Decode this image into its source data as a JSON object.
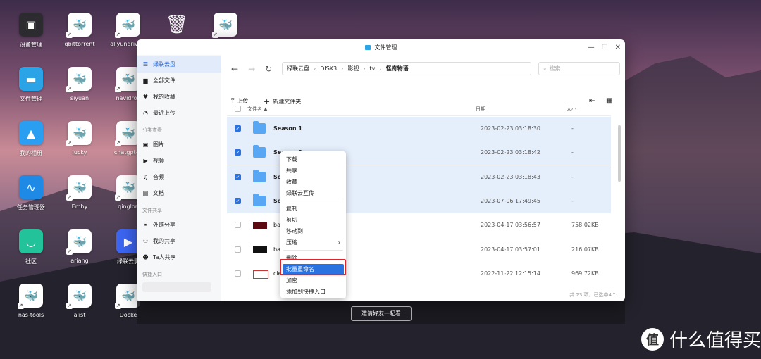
{
  "desktop": {
    "icons": [
      {
        "label": "设备管理",
        "icon": "device-icon"
      },
      {
        "label": "qbittorrent",
        "icon": "docker-icon"
      },
      {
        "label": "aliyundrive-s",
        "icon": "docker-icon"
      },
      {
        "label": "",
        "icon": "trash-icon"
      },
      {
        "label": "",
        "icon": "docker-icon"
      },
      {
        "label": "文件管理",
        "icon": "folder-icon"
      },
      {
        "label": "siyuan",
        "icon": "docker-icon"
      },
      {
        "label": "navidron",
        "icon": "docker-icon"
      },
      {
        "label": "我的相册",
        "icon": "photo-icon"
      },
      {
        "label": "lucky",
        "icon": "docker-icon"
      },
      {
        "label": "chatgpt-w",
        "icon": "docker-icon"
      },
      {
        "label": "任务管理器",
        "icon": "chart-icon"
      },
      {
        "label": "Emby",
        "icon": "docker-icon"
      },
      {
        "label": "qinglon",
        "icon": "docker-icon"
      },
      {
        "label": "社区",
        "icon": "community-icon"
      },
      {
        "label": "ariang",
        "icon": "docker-icon"
      },
      {
        "label": "绿联云影",
        "icon": "tv-icon"
      },
      {
        "label": "nas-tools",
        "icon": "docker-icon"
      },
      {
        "label": "alist",
        "icon": "docker-icon"
      },
      {
        "label": "Docke",
        "icon": "docker-icon"
      }
    ]
  },
  "window": {
    "title": "文件管理",
    "controls": [
      "—",
      "☐",
      "✕"
    ]
  },
  "sidebar": {
    "items": [
      {
        "label": "绿联云盘",
        "icon": "list-icon",
        "active": true
      },
      {
        "label": "全部文件",
        "icon": "file-icon"
      },
      {
        "label": "我的收藏",
        "icon": "heart-icon"
      },
      {
        "label": "最近上传",
        "icon": "clock-icon"
      }
    ],
    "section_category": "分类查看",
    "categories": [
      {
        "label": "图片",
        "icon": "image-icon"
      },
      {
        "label": "视频",
        "icon": "video-icon"
      },
      {
        "label": "音频",
        "icon": "headphone-icon"
      },
      {
        "label": "文档",
        "icon": "doc-icon"
      }
    ],
    "section_share": "文件共享",
    "shares": [
      {
        "label": "外链分享",
        "icon": "link-icon"
      },
      {
        "label": "我的共享",
        "icon": "share-icon"
      },
      {
        "label": "Ta人共享",
        "icon": "user-icon"
      }
    ],
    "section_quick": "快捷入口"
  },
  "breadcrumb": [
    "绿联云盘",
    "DISK3",
    "影视",
    "tv",
    "怪奇物语"
  ],
  "search": {
    "placeholder": "搜索"
  },
  "toolbar": {
    "upload": "上传",
    "new_folder": "新建文件夹"
  },
  "table": {
    "headers": {
      "name": "文件名",
      "date": "日期",
      "size": "大小"
    },
    "rows": [
      {
        "name": "Season 1",
        "date": "2023-02-23 03:18:30",
        "size": "-",
        "type": "folder",
        "checked": true
      },
      {
        "name": "Season 2",
        "date": "2023-02-23 03:18:42",
        "size": "-",
        "type": "folder",
        "checked": true
      },
      {
        "name": "Seas",
        "date": "2023-02-23 03:18:43",
        "size": "-",
        "type": "folder",
        "checked": true
      },
      {
        "name": "Seas",
        "date": "2023-07-06 17:49:45",
        "size": "-",
        "type": "folder",
        "checked": true
      },
      {
        "name": "backg",
        "date": "2023-04-17 03:56:57",
        "size": "758.02KB",
        "type": "image",
        "checked": false
      },
      {
        "name": "banne",
        "date": "2023-04-17 03:57:01",
        "size": "216.07KB",
        "type": "image",
        "checked": false
      },
      {
        "name": "clear",
        "date": "2022-11-22 12:15:14",
        "size": "969.72KB",
        "type": "image",
        "checked": false
      }
    ],
    "footer": "共 23 项，已选中4个"
  },
  "context_menu": [
    {
      "label": "下载"
    },
    {
      "label": "共享"
    },
    {
      "label": "收藏"
    },
    {
      "label": "绿联云互传"
    },
    {
      "label": "复制"
    },
    {
      "label": "剪切"
    },
    {
      "label": "移动到"
    },
    {
      "label": "压缩",
      "submenu": true
    },
    {
      "label": "删除"
    },
    {
      "label": "批量重命名",
      "highlighted": true
    },
    {
      "label": "加密"
    },
    {
      "label": "添加到快捷入口"
    }
  ],
  "invite_button": "邀请好友一起看",
  "watermark": {
    "logo": "值",
    "text": "什么值得买"
  },
  "colors": {
    "accent": "#2a72e0",
    "highlight_box": "#e0242c",
    "folder": "#57a7f5"
  }
}
